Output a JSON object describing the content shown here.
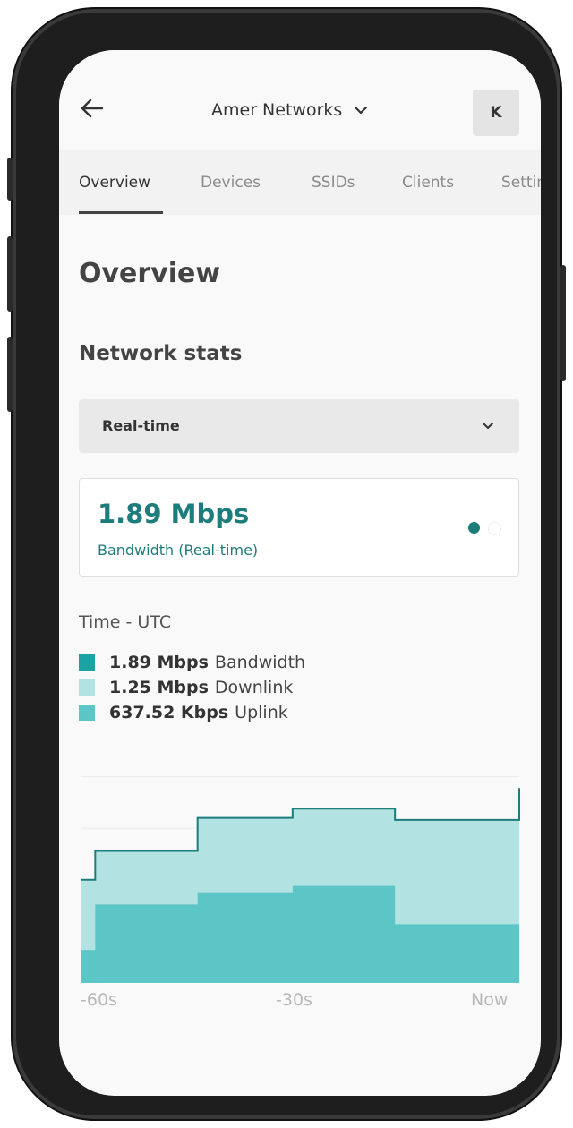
{
  "header": {
    "network_name": "Amer Networks",
    "avatar_initial": "K"
  },
  "tabs": [
    "Overview",
    "Devices",
    "SSIDs",
    "Clients",
    "Settings"
  ],
  "page_title": "Overview",
  "section_title": "Network stats",
  "range_select": {
    "value": "Real-time"
  },
  "stat_card": {
    "value": "1.89 Mbps",
    "label": "Bandwidth (Real-time)"
  },
  "time_label": "Time - UTC",
  "legend": [
    {
      "value": "1.89 Mbps",
      "name": "Bandwidth",
      "color": "#1aa3a3"
    },
    {
      "value": "1.25 Mbps",
      "name": "Downlink",
      "color": "#b2e2e2"
    },
    {
      "value": "637.52 Kbps",
      "name": "Uplink",
      "color": "#5cc6c6"
    }
  ],
  "colors": {
    "accent": "#1d7c7c"
  },
  "chart_data": {
    "type": "area",
    "x_ticks": [
      "-60s",
      "-30s",
      "Now"
    ],
    "x": [
      -60,
      -58,
      -54,
      -44,
      -31,
      -26,
      -17,
      0
    ],
    "series": [
      {
        "name": "Bandwidth",
        "step": true,
        "values": [
          1.0,
          1.28,
          1.28,
          1.6,
          1.69,
          1.69,
          1.58,
          1.89
        ]
      },
      {
        "name": "Uplink",
        "step": true,
        "values": [
          0.32,
          0.76,
          0.76,
          0.88,
          0.94,
          0.94,
          0.57,
          0.71
        ]
      }
    ],
    "ylim": [
      0,
      2.1
    ],
    "grid": true
  }
}
